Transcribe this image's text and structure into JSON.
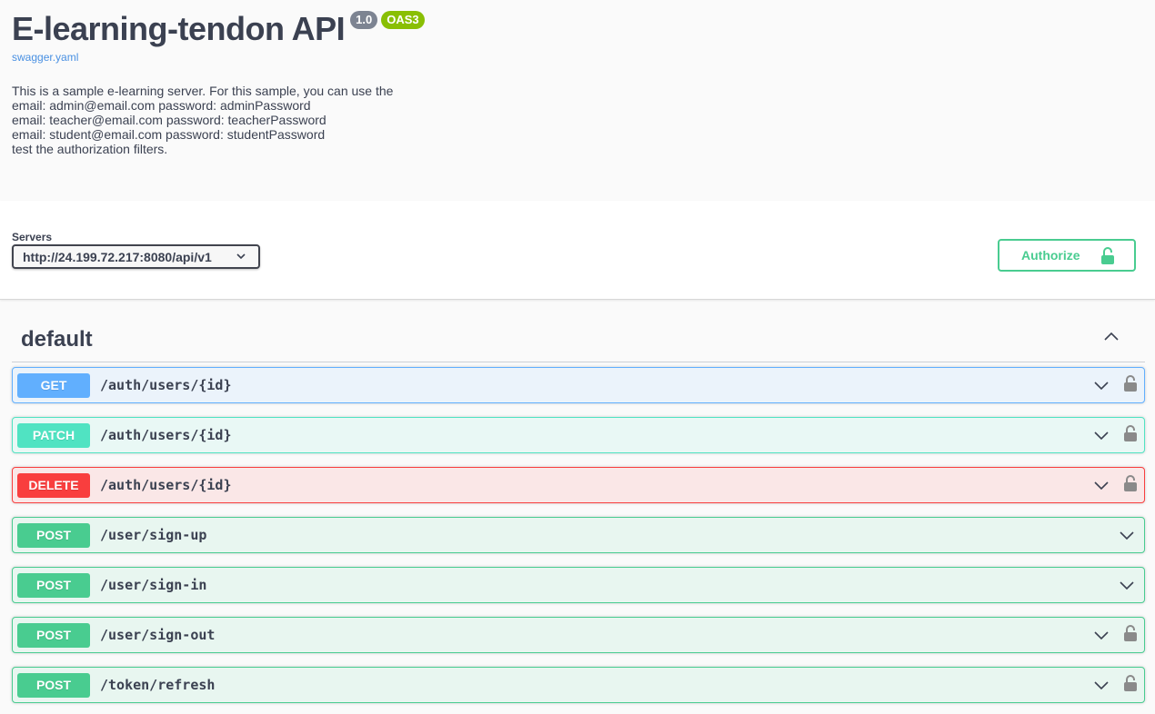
{
  "info": {
    "title": "E-learning-tendon API",
    "version": "1.0",
    "oas": "OAS3",
    "spec_link": "swagger.yaml",
    "description_lines": [
      "This is a sample e-learning server. For this sample, you can use the",
      "email: admin@email.com password: adminPassword",
      "email: teacher@email.com password: teacherPassword",
      "email: student@email.com password: studentPassword",
      "test the authorization filters."
    ]
  },
  "servers": {
    "label": "Servers",
    "selected": "http://24.199.72.217:8080/api/v1"
  },
  "authorize": {
    "label": "Authorize",
    "icon": "unlocked-lock-icon",
    "color": "#49cc90"
  },
  "tag": {
    "name": "default",
    "expanded": true
  },
  "operations": [
    {
      "method": "GET",
      "path": "/auth/users/{id}",
      "locked": true
    },
    {
      "method": "PATCH",
      "path": "/auth/users/{id}",
      "locked": true
    },
    {
      "method": "DELETE",
      "path": "/auth/users/{id}",
      "locked": true
    },
    {
      "method": "POST",
      "path": "/user/sign-up",
      "locked": false
    },
    {
      "method": "POST",
      "path": "/user/sign-in",
      "locked": false
    },
    {
      "method": "POST",
      "path": "/user/sign-out",
      "locked": true
    },
    {
      "method": "POST",
      "path": "/token/refresh",
      "locked": true
    }
  ],
  "colors": {
    "get": "#61affe",
    "patch": "#50e3c2",
    "delete": "#f93e3e",
    "post": "#49cc90",
    "version_badge": "#7d8492",
    "oas_badge": "#89bf04",
    "link": "#4990e2"
  }
}
